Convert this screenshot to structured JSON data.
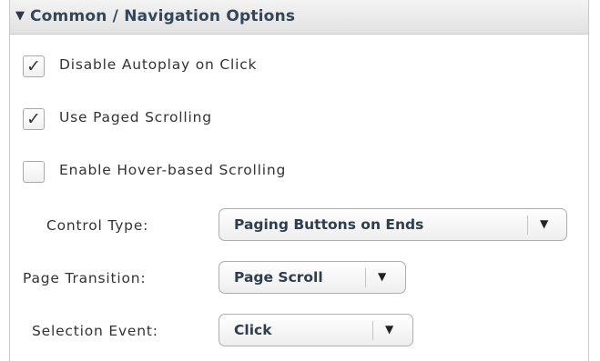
{
  "section": {
    "title": "Common / Navigation Options",
    "collapse_icon": "triangle-down-icon"
  },
  "checkboxes": [
    {
      "label": "Disable Autoplay on Click",
      "checked": true
    },
    {
      "label": "Use Paged Scrolling",
      "checked": true
    },
    {
      "label": "Enable Hover-based Scrolling",
      "checked": false
    }
  ],
  "fields": [
    {
      "label": "Control Type:",
      "value": "Paging Buttons on Ends"
    },
    {
      "label": "Page Transition:",
      "value": "Page Scroll"
    },
    {
      "label": "Selection Event:",
      "value": "Click"
    }
  ],
  "icons": {
    "check": "checkmark-icon",
    "dropdown": "triangle-down-icon"
  },
  "glyphs": {
    "check": "✓",
    "dropdown": "▼",
    "collapse": "▼"
  }
}
